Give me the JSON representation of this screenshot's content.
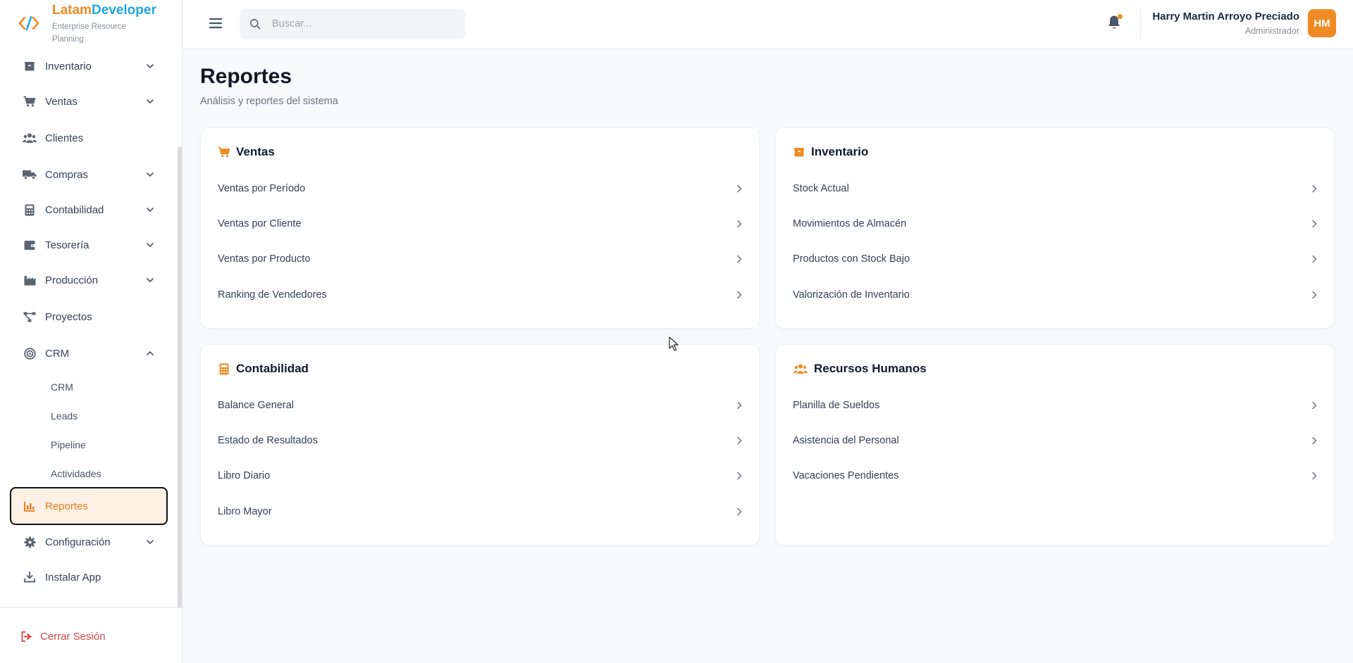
{
  "brand": {
    "name_part1": "Latam",
    "name_part2": "Developer",
    "subtitle": "Enterprise Resource Planning"
  },
  "sidebar": {
    "items": [
      {
        "label": "Inventario",
        "icon": "box-icon",
        "expandable": true
      },
      {
        "label": "Ventas",
        "icon": "cart-icon",
        "expandable": true
      },
      {
        "label": "Clientes",
        "icon": "users-icon",
        "expandable": false
      },
      {
        "label": "Compras",
        "icon": "truck-icon",
        "expandable": true
      },
      {
        "label": "Contabilidad",
        "icon": "calculator-icon",
        "expandable": true
      },
      {
        "label": "Tesorería",
        "icon": "wallet-icon",
        "expandable": true
      },
      {
        "label": "Producción",
        "icon": "factory-icon",
        "expandable": true
      },
      {
        "label": "Proyectos",
        "icon": "diagram-icon",
        "expandable": false
      },
      {
        "label": "CRM",
        "icon": "target-icon",
        "expandable": true,
        "expanded": true
      }
    ],
    "crm_sub": [
      "CRM",
      "Leads",
      "Pipeline",
      "Actividades"
    ],
    "active": {
      "label": "Reportes",
      "icon": "chart-icon"
    },
    "bottom": [
      {
        "label": "Configuración",
        "icon": "gear-icon",
        "expandable": true
      },
      {
        "label": "Instalar App",
        "icon": "download-icon",
        "expandable": false
      }
    ],
    "logout": "Cerrar Sesión"
  },
  "header": {
    "search_placeholder": "Buscar...",
    "user_name": "Harry Martin Arroyo Preciado",
    "user_role": "Administrador",
    "avatar_initials": "HM"
  },
  "main": {
    "title": "Reportes",
    "subtitle": "Análisis y reportes del sistema",
    "cards": [
      {
        "title": "Ventas",
        "icon": "cart-icon",
        "links": [
          "Ventas por Período",
          "Ventas por Cliente",
          "Ventas por Producto",
          "Ranking de Vendedores"
        ]
      },
      {
        "title": "Inventario",
        "icon": "box-icon",
        "links": [
          "Stock Actual",
          "Movimientos de Almacén",
          "Productos con Stock Bajo",
          "Valorización de Inventario"
        ]
      },
      {
        "title": "Contabilidad",
        "icon": "calculator-icon",
        "links": [
          "Balance General",
          "Estado de Resultados",
          "Libro Diario",
          "Libro Mayor"
        ]
      },
      {
        "title": "Recursos Humanos",
        "icon": "users-icon",
        "links": [
          "Planilla de Sueldos",
          "Asistencia del Personal",
          "Vacaciones Pendientes"
        ]
      }
    ]
  },
  "colors": {
    "accent": "#f08a24",
    "brand_blue": "#1ea8e0",
    "logout": "#d94343",
    "active_bg": "#fdf0e5"
  }
}
